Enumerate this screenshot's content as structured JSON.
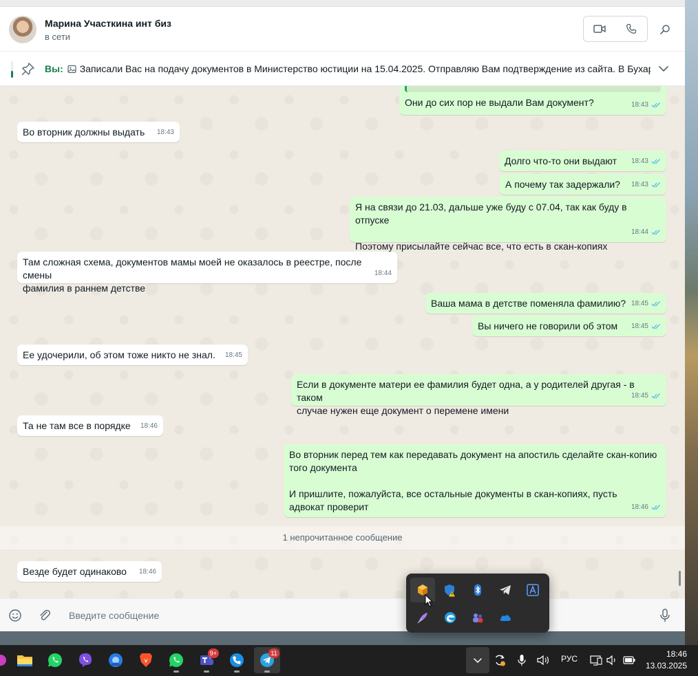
{
  "header": {
    "contact_name": "Марина Участкина инт биз",
    "status": "в сети"
  },
  "pinned": {
    "sender": "Вы:",
    "text": "Записали Вас на подачу документов в Министерство юстиции на 15.04.2025. Отправляю Вам подтверждение из сайта.  В Бухар..."
  },
  "messages": [
    {
      "dir": "out",
      "text": "Они до сих пор не выдали Вам документ?",
      "time": "18:43"
    },
    {
      "dir": "in",
      "text": "Во вторник должны выдать",
      "time": "18:43"
    },
    {
      "dir": "out",
      "text": "Долго что-то они выдают",
      "time": "18:43"
    },
    {
      "dir": "out",
      "text": "А почему так задержали?",
      "time": "18:43"
    },
    {
      "dir": "out",
      "text": "Я на связи до 21.03, дальше уже буду с 07.04, так как буду в отпуске\n\nПоэтому присылайте сейчас все, что есть в скан-копиях",
      "time": "18:44"
    },
    {
      "dir": "in",
      "text": "Там сложная схема, документов мамы моей не оказалось в реестре, после смены\nфамилия в раннем детстве",
      "time": "18:44"
    },
    {
      "dir": "out",
      "text": "Ваша мама в детстве поменяла фамилию?",
      "time": "18:45"
    },
    {
      "dir": "out",
      "text": "Вы ничего не говорили об этом",
      "time": "18:45"
    },
    {
      "dir": "in",
      "text": "Ее удочерили, об этом тоже никто не знал.",
      "time": "18:45"
    },
    {
      "dir": "out",
      "text": "Если в документе матери ее фамилия будет одна, а у родителей другая - в таком\nслучае нужен еще документ о перемене имени",
      "time": "18:45"
    },
    {
      "dir": "in",
      "text": "Та не там все в порядке",
      "time": "18:46"
    },
    {
      "dir": "out",
      "text": "Во вторник перед тем как передавать документ на апостиль сделайте скан-копию\nтого документа\n\nИ пришлите, пожалуйста, все остальные документы в скан-копиях, пусть\nадвокат проверит",
      "time": "18:46"
    },
    {
      "dir": "in",
      "text": "Везде будет одинаково",
      "time": "18:46"
    }
  ],
  "unread_separator": "1 непрочитанное сообщение",
  "composer": {
    "placeholder": "Введите сообщение"
  },
  "tray_flyout": {
    "icons": [
      "box-app-icon",
      "defender-warning-icon",
      "bluetooth-icon",
      "telegram-icon",
      "language-a-icon",
      "quill-icon",
      "edge-icon",
      "teams-icon",
      "onedrive-icon"
    ]
  },
  "taskbar": {
    "apps": [
      {
        "name": "file-explorer-icon",
        "badge": ""
      },
      {
        "name": "whatsapp-icon",
        "badge": ""
      },
      {
        "name": "viber-icon",
        "badge": ""
      },
      {
        "name": "app-blue-circle-icon",
        "badge": ""
      },
      {
        "name": "brave-icon",
        "badge": ""
      },
      {
        "name": "whatsapp-icon-2",
        "badge": ""
      },
      {
        "name": "teams-icon",
        "badge": "9+"
      },
      {
        "name": "phone-icon",
        "badge": ""
      },
      {
        "name": "telegram-icon",
        "badge": "11"
      }
    ],
    "language": "РУС",
    "time": "18:46",
    "date": "13.03.2025"
  },
  "colors": {
    "outgoing_bubble": "#d9fdd3",
    "incoming_bubble": "#ffffff",
    "chat_background": "#efeae2",
    "accent_green": "#1a7f4b",
    "read_check": "#53bdeb"
  }
}
